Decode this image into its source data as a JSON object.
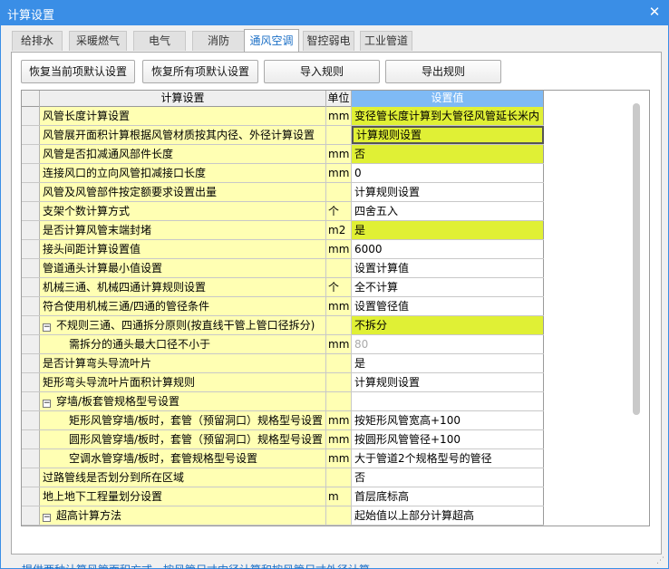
{
  "window": {
    "title": "计算设置"
  },
  "tabs": [
    "给排水",
    "采暖燃气",
    "电气",
    "消防",
    "通风空调",
    "智控弱电",
    "工业管道"
  ],
  "active_tab": 4,
  "buttons": {
    "restore_current": "恢复当前项默认设置",
    "restore_all": "恢复所有项默认设置",
    "import": "导入规则",
    "export": "导出规则"
  },
  "table": {
    "headers": {
      "name": "计算设置",
      "unit": "单位",
      "value": "设置值"
    },
    "rows": [
      {
        "name": "风管长度计算设置",
        "unit": "mm",
        "value": "变径管长度计算到大管径风管延长米内"
      },
      {
        "name": "风管展开面积计算根据风管材质按其内径、外径计算设置",
        "unit": "",
        "value": "计算规则设置"
      },
      {
        "name": "风管是否扣减通风部件长度",
        "unit": "mm",
        "value": "否"
      },
      {
        "name": "连接风口的立向风管扣减接口长度",
        "unit": "mm",
        "value": "0"
      },
      {
        "name": "风管及风管部件按定额要求设置出量",
        "unit": "",
        "value": "计算规则设置"
      },
      {
        "name": "支架个数计算方式",
        "unit": "个",
        "value": "四舍五入"
      },
      {
        "name": "是否计算风管末端封堵",
        "unit": "m2",
        "value": "是"
      },
      {
        "name": "接头间距计算设置值",
        "unit": "mm",
        "value": "6000"
      },
      {
        "name": "管道通头计算最小值设置",
        "unit": "",
        "value": "设置计算值"
      },
      {
        "name": "机械三通、机械四通计算规则设置",
        "unit": "个",
        "value": "全不计算"
      },
      {
        "name": "符合使用机械三通/四通的管径条件",
        "unit": "mm",
        "value": "设置管径值"
      },
      {
        "name": "不规则三通、四通拆分原则(按直线干管上管口径拆分)",
        "unit": "",
        "value": "不拆分"
      },
      {
        "name": "需拆分的通头最大口径不小于",
        "unit": "mm",
        "value": "80"
      },
      {
        "name": "是否计算弯头导流叶片",
        "unit": "",
        "value": "是"
      },
      {
        "name": "矩形弯头导流叶片面积计算规则",
        "unit": "",
        "value": "计算规则设置"
      },
      {
        "name": "穿墙/板套管规格型号设置",
        "unit": "",
        "value": ""
      },
      {
        "name": "矩形风管穿墙/板时，套管（预留洞口）规格型号设置",
        "unit": "mm",
        "value": "按矩形风管宽高+100"
      },
      {
        "name": "圆形风管穿墙/板时，套管（预留洞口）规格型号设置",
        "unit": "mm",
        "value": "按圆形风管管径+100"
      },
      {
        "name": "空调水管穿墙/板时，套管规格型号设置",
        "unit": "mm",
        "value": "大于管道2个规格型号的管径"
      },
      {
        "name": "过路管线是否划分到所在区域",
        "unit": "",
        "value": "否"
      },
      {
        "name": "地上地下工程量划分设置",
        "unit": "m",
        "value": "首层底标高"
      },
      {
        "name": "超高计算方法",
        "unit": "",
        "value": "起始值以上部分计算超高"
      }
    ]
  },
  "hint": "提供两种计算风管面积方式，按风管尺寸内径计算和按风管尺寸外径计算"
}
